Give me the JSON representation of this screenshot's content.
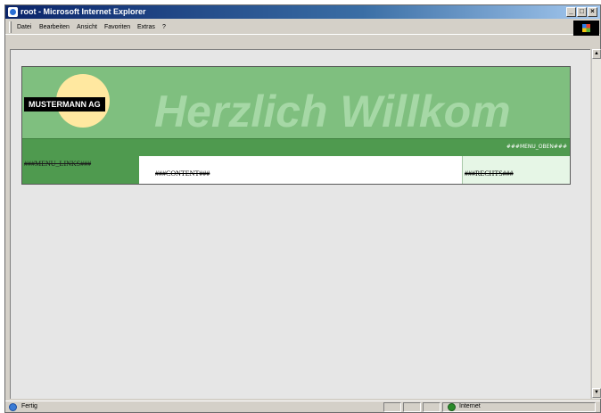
{
  "window": {
    "title": "root - Microsoft Internet Explorer",
    "controls": {
      "minimize": "_",
      "maximize": "□",
      "close": "×"
    }
  },
  "menubar": {
    "items": [
      "Datei",
      "Bearbeiten",
      "Ansicht",
      "Favoriten",
      "Extras",
      "?"
    ]
  },
  "page": {
    "company": "MUSTERMANN AG",
    "welcome": "Herzlich Willkom",
    "menu_top": "###MENU_OBEN###",
    "menu_left": "###MENU_LINKS###",
    "content": "###CONTENT###",
    "right": "###RECHTS###",
    "colors": {
      "banner": "#7fbf7f",
      "bar": "#4f9a4f",
      "right_panel": "#e6f6e6",
      "sun": "#ffe8a0"
    }
  },
  "status": {
    "text": "Fertig",
    "zone": "Internet"
  },
  "icons": {
    "status": "ie-page-icon",
    "zone": "internet-globe-icon",
    "brand": "windows-logo-icon"
  }
}
